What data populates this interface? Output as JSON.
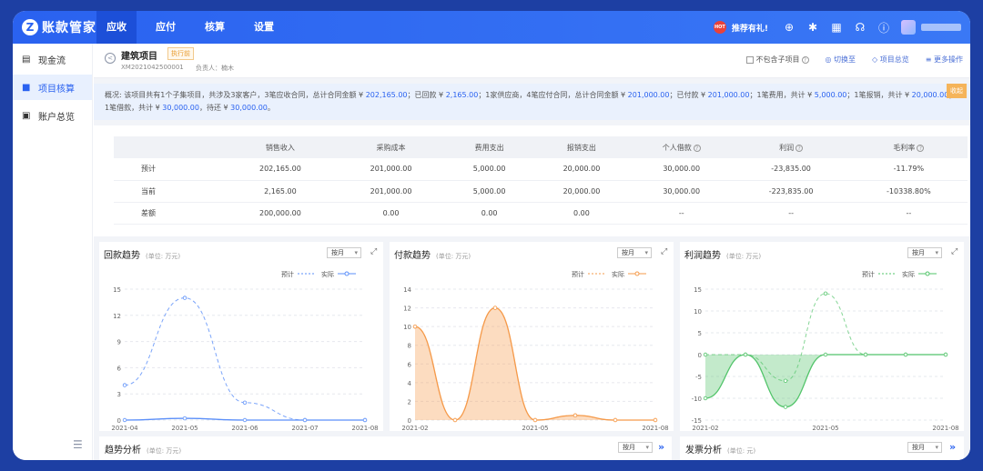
{
  "app": {
    "logo_mark": "Z",
    "name": "账款管家"
  },
  "nav": [
    {
      "label": "应收",
      "active": true
    },
    {
      "label": "应付",
      "active": false
    },
    {
      "label": "核算",
      "active": false
    },
    {
      "label": "设置",
      "active": false
    }
  ],
  "topbar": {
    "promo_badge": "HOT",
    "promo_text": "推荐有礼!",
    "icons": [
      "plus-circle-icon",
      "bug-icon",
      "apps-icon",
      "headset-icon",
      "help-icon"
    ]
  },
  "sidebar": [
    {
      "label": "现金流",
      "icon": "cash-icon",
      "active": false
    },
    {
      "label": "项目核算",
      "icon": "folder-icon",
      "active": true
    },
    {
      "label": "账户总览",
      "icon": "account-icon",
      "active": false
    }
  ],
  "project": {
    "name": "建筑项目",
    "status": "执行前",
    "code": "XM2021042500001",
    "owner": "负责人：楠木",
    "exclude_sub": "不包含子项目",
    "switch_label": "切换至",
    "overview_label": "项目总览",
    "more_label": "更多操作"
  },
  "summary": {
    "p1": "概况:  该项目共有1个子集项目，共涉及3家客户，3笔应收合同，总计合同金额 ¥ ",
    "v1": "202,165.00",
    "p2": "；已回款 ¥ ",
    "v2": "2,165.00",
    "p3": "；1家供应商，4笔应付合同，总计合同金额 ¥ ",
    "v3": "201,000.00",
    "p4": "；已付款 ¥ ",
    "v4": "201,000.00",
    "p5": "；1笔费用，共计 ¥ ",
    "v5": "5,000.00",
    "p6": "；1笔报销，共计 ¥ ",
    "v6": "20,000.00",
    "p7": "；1笔借款，共计 ¥ ",
    "v7": "30,000.00",
    "p8": "，待还 ¥ ",
    "v8": "30,000.00",
    "p9": "。",
    "corner": "收起"
  },
  "table": {
    "headers": [
      "",
      "销售收入",
      "采购成本",
      "费用支出",
      "报销支出",
      "个人借款",
      "利润",
      "毛利率"
    ],
    "rows": [
      [
        "预计",
        "202,165.00",
        "201,000.00",
        "5,000.00",
        "20,000.00",
        "30,000.00",
        "-23,835.00",
        "-11.79%"
      ],
      [
        "当前",
        "2,165.00",
        "201,000.00",
        "5,000.00",
        "20,000.00",
        "30,000.00",
        "-223,835.00",
        "-10338.80%"
      ],
      [
        "差额",
        "200,000.00",
        "0.00",
        "0.00",
        "0.00",
        "--",
        "--",
        "--"
      ]
    ]
  },
  "charts": {
    "unit": "(单位: 万元)",
    "period": "按月",
    "legend_plan": "预计",
    "legend_actual": "实际"
  },
  "chart_data": [
    {
      "type": "line",
      "title": "回款趋势",
      "x": [
        "2021-04",
        "2021-05",
        "2021-06",
        "2021-07",
        "2021-08"
      ],
      "ylim": [
        0,
        15
      ],
      "yticks": [
        "15",
        "12",
        "9",
        "6",
        "3",
        "0"
      ],
      "series": [
        {
          "name": "预计",
          "values": [
            4,
            14,
            2,
            0,
            0
          ]
        },
        {
          "name": "实际",
          "values": [
            0,
            0.2,
            0,
            0,
            0
          ]
        }
      ],
      "color": "#5b8ff9"
    },
    {
      "type": "area",
      "title": "付款趋势",
      "x": [
        "2021-02",
        "2021-05",
        "2021-08"
      ],
      "ylim": [
        0,
        14
      ],
      "yticks": [
        "14",
        "12",
        "10",
        "8",
        "6",
        "4",
        "2",
        "0"
      ],
      "series": [
        {
          "name": "预计",
          "values": [
            10,
            0,
            12,
            0,
            0.5,
            0,
            0
          ]
        },
        {
          "name": "实际",
          "values": [
            10,
            0,
            12,
            0,
            0.5,
            0,
            0
          ]
        }
      ],
      "color": "#f59a4a"
    },
    {
      "type": "area",
      "title": "利润趋势",
      "x": [
        "2021-02",
        "2021-05",
        "2021-08"
      ],
      "ylim": [
        -15,
        15
      ],
      "yticks": [
        "15",
        "10",
        "5",
        "0",
        "-5",
        "-10",
        "-15"
      ],
      "series": [
        {
          "name": "预计",
          "values": [
            0,
            0,
            -6,
            14,
            0,
            0,
            0
          ]
        },
        {
          "name": "实际",
          "values": [
            -10,
            0,
            -12,
            0,
            0,
            0,
            0
          ]
        }
      ],
      "color": "#52c46a"
    }
  ],
  "bottom": {
    "trend_title": "趋势分析",
    "trend_unit": "(单位: 万元)",
    "invoice_title": "发票分析",
    "invoice_unit": "(单位: 元)",
    "period": "按月"
  }
}
